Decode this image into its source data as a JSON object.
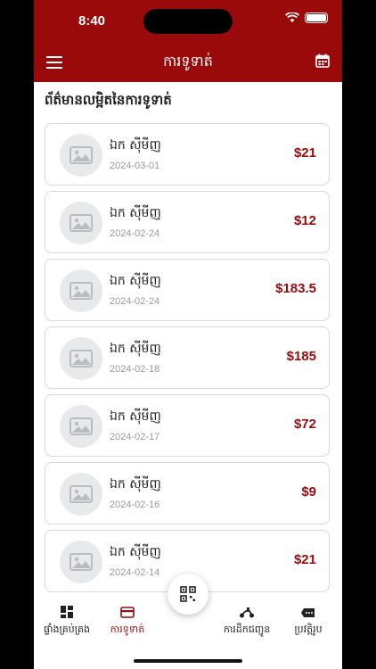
{
  "status_bar": {
    "time": "8:40"
  },
  "header": {
    "title": "ការទូទាត់"
  },
  "section_title": "ព័ត៌មានលម្អិតនៃការទូទាត់",
  "payments": [
    {
      "name": "ឯក ស៊ីមីញ",
      "date": "2024-03-01",
      "amount": "$21"
    },
    {
      "name": "ឯក ស៊ីមីញ",
      "date": "2024-02-24",
      "amount": "$12"
    },
    {
      "name": "ឯក ស៊ីមីញ",
      "date": "2024-02-24",
      "amount": "$183.5"
    },
    {
      "name": "ឯក ស៊ីមីញ",
      "date": "2024-02-18",
      "amount": "$185"
    },
    {
      "name": "ឯក ស៊ីមីញ",
      "date": "2024-02-17",
      "amount": "$72"
    },
    {
      "name": "ឯក ស៊ីមីញ",
      "date": "2024-02-16",
      "amount": "$9"
    },
    {
      "name": "ឯក ស៊ីមីញ",
      "date": "2024-02-14",
      "amount": "$21"
    }
  ],
  "tabs": [
    {
      "label": "ផ្ទាំងគ្រប់គ្រង",
      "icon": "dashboard-icon"
    },
    {
      "label": "ការទូទាត់",
      "icon": "card-icon",
      "active": true
    },
    {
      "label": "ការដឹកជញ្ជូន",
      "icon": "scooter-icon"
    },
    {
      "label": "ប្រវត្តិរូប",
      "icon": "profile-icon"
    }
  ],
  "colors": {
    "brand": "#9a0a0a",
    "placeholder_bg": "#e8e9eb"
  }
}
